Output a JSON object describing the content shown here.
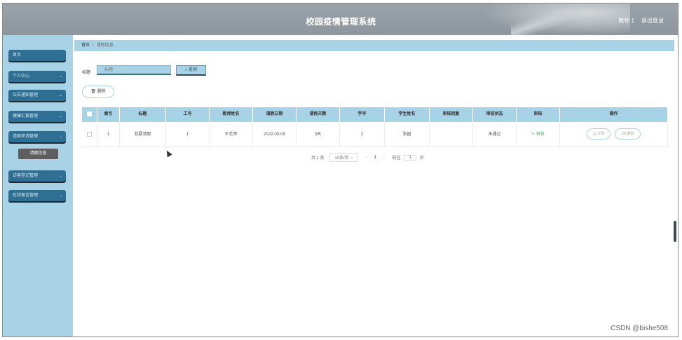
{
  "header": {
    "title": "校园疫情管理系统",
    "user": "教师 1",
    "logout": "退出登录"
  },
  "sidebar": {
    "items": [
      {
        "label": "首页",
        "has_chevron": false
      },
      {
        "label": "个人中心",
        "has_chevron": true
      },
      {
        "label": "公告通知管理",
        "has_chevron": true
      },
      {
        "label": "健康汇报管理",
        "has_chevron": true
      },
      {
        "label": "请假申请管理",
        "has_chevron": true
      },
      {
        "label": "访客登记管理",
        "has_chevron": true
      },
      {
        "label": "在线留言管理",
        "has_chevron": true
      }
    ],
    "active_sub": "请假信息"
  },
  "breadcrumb": {
    "home": "首页",
    "current": "请假信息"
  },
  "search": {
    "label": "标题",
    "placeholder": "标题",
    "button": "查询",
    "icon": "search-icon"
  },
  "actions": {
    "delete": "删除"
  },
  "table": {
    "headers": [
      "",
      "索引",
      "标题",
      "工号",
      "教师姓名",
      "请假日期",
      "请假天数",
      "学号",
      "学生姓名",
      "审核回复",
      "审核状态",
      "审核",
      "操作"
    ],
    "rows": [
      {
        "index": "1",
        "title": "我要请假",
        "staff_no": "1",
        "teacher_name": "王老师",
        "leave_date": "2022-03-09",
        "days": "3天",
        "student_no": "2",
        "student_name": "张园",
        "reply": "",
        "status": "未通过",
        "audit": "审核",
        "detail": "详情",
        "delete": "删除"
      }
    ]
  },
  "pagination": {
    "total": "共 1 条",
    "page_size": "10条/页",
    "current": "1",
    "goto": "前往",
    "goto_value": "1",
    "page_unit": "页"
  },
  "watermark": "CSDN @bishe508",
  "colors": {
    "header": "#9aa3aa",
    "sidebar": "#a8d2e6",
    "menu": "#2f6f93",
    "accent": "#a8d2e6"
  }
}
